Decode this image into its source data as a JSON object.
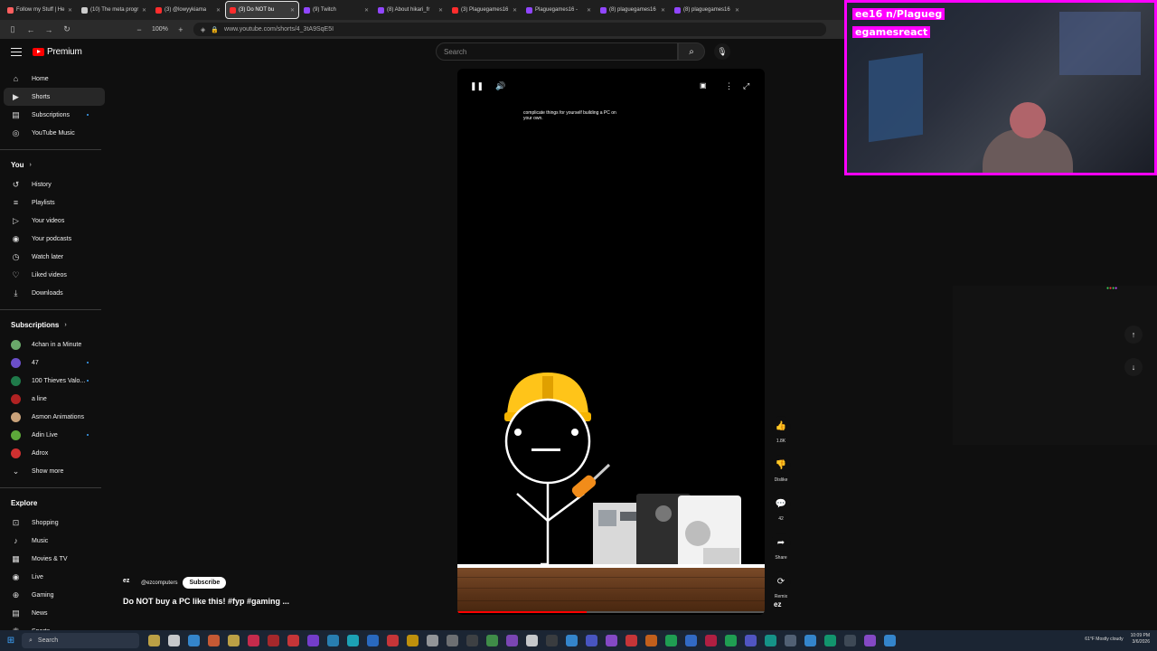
{
  "browser": {
    "tabs": [
      {
        "label": "Follow my Stuff | He",
        "color": "#ff5f5f",
        "active": false
      },
      {
        "label": "(10) The meta progr",
        "color": "#cccccc",
        "active": false
      },
      {
        "label": "(3) @lowyykiama",
        "color": "#ff2d2d",
        "active": false
      },
      {
        "label": "(3) Do NOT bu",
        "color": "#ff2d2d",
        "active": true
      },
      {
        "label": "(9) Twitch",
        "color": "#9146ff",
        "active": false
      },
      {
        "label": "(8) About hikari_fr",
        "color": "#9146ff",
        "active": false
      },
      {
        "label": "(3) Plaguegames16",
        "color": "#ff2d2d",
        "active": false
      },
      {
        "label": "Plaguegames16 -",
        "color": "#9146ff",
        "active": false
      },
      {
        "label": "(8) plaguegames16",
        "color": "#9146ff",
        "active": false
      },
      {
        "label": "(8) plaguegames16",
        "color": "#9146ff",
        "active": false
      }
    ],
    "zoom": "100%",
    "url": "www.youtube.com/shorts/4_3tA9SqE5I"
  },
  "header": {
    "logo_text": "Premium",
    "search_placeholder": "Search"
  },
  "sidebar": {
    "main": [
      {
        "label": "Home",
        "icon": "home-icon",
        "glyph": "⌂"
      },
      {
        "label": "Shorts",
        "icon": "shorts-icon",
        "glyph": "▶",
        "active": true
      },
      {
        "label": "Subscriptions",
        "icon": "subscriptions-icon",
        "glyph": "▤",
        "dot": true
      },
      {
        "label": "YouTube Music",
        "icon": "music-circle-icon",
        "glyph": "◎"
      }
    ],
    "you_heading": "You",
    "you": [
      {
        "label": "History",
        "icon": "history-icon",
        "glyph": "↺"
      },
      {
        "label": "Playlists",
        "icon": "playlists-icon",
        "glyph": "≡"
      },
      {
        "label": "Your videos",
        "icon": "your-videos-icon",
        "glyph": "▷"
      },
      {
        "label": "Your podcasts",
        "icon": "podcasts-icon",
        "glyph": "◉"
      },
      {
        "label": "Watch later",
        "icon": "clock-icon",
        "glyph": "◷"
      },
      {
        "label": "Liked videos",
        "icon": "like-icon",
        "glyph": "♡"
      },
      {
        "label": "Downloads",
        "icon": "download-icon",
        "glyph": "⤓"
      }
    ],
    "subs_heading": "Subscriptions",
    "subs": [
      {
        "label": "4chan in a Minute",
        "color": "#6aa86a"
      },
      {
        "label": "47",
        "color": "#6b4fc9",
        "dot": true
      },
      {
        "label": "100 Thieves Valo...",
        "color": "#1f7a4a",
        "dot": true
      },
      {
        "label": "a line",
        "color": "#b02222"
      },
      {
        "label": "Asmon Animations",
        "color": "#c9a27a"
      },
      {
        "label": "Adin Live",
        "color": "#5da83a",
        "dot": true
      },
      {
        "label": "Adrox",
        "color": "#d03030"
      }
    ],
    "show_more": "Show more",
    "explore_heading": "Explore",
    "explore": [
      {
        "label": "Shopping",
        "icon": "shopping-bag-icon",
        "glyph": "⊡"
      },
      {
        "label": "Music",
        "icon": "music-note-icon",
        "glyph": "♪"
      },
      {
        "label": "Movies & TV",
        "icon": "movies-icon",
        "glyph": "▦"
      },
      {
        "label": "Live",
        "icon": "live-icon",
        "glyph": "◉"
      },
      {
        "label": "Gaming",
        "icon": "gaming-icon",
        "glyph": "⊕"
      },
      {
        "label": "News",
        "icon": "news-icon",
        "glyph": "▤"
      },
      {
        "label": "Sports",
        "icon": "trophy-icon",
        "glyph": "♛"
      }
    ]
  },
  "short": {
    "caption": "complicate things for yourself building a PC on your own.",
    "progress": 0.42,
    "channel_logo": "ez",
    "channel": "@ezcomputers",
    "subscribe": "Subscribe",
    "title": "Do NOT buy a PC like this! #fyp #gaming ..."
  },
  "actions": [
    {
      "name": "like-button",
      "icon": "thumbs-up-icon",
      "glyph": "👍",
      "label": "1.8K"
    },
    {
      "name": "dislike-button",
      "icon": "thumbs-down-icon",
      "glyph": "👎",
      "label": "Dislike"
    },
    {
      "name": "comments-button",
      "icon": "comment-icon",
      "glyph": "💬",
      "label": "42"
    },
    {
      "name": "share-button",
      "icon": "share-icon",
      "glyph": "➦",
      "label": "Share"
    },
    {
      "name": "remix-button",
      "icon": "remix-icon",
      "glyph": "⟳",
      "label": "Remix"
    }
  ],
  "webcam": {
    "label_top": "ee16 n/Plagueg",
    "label_bottom": "egamesreact"
  },
  "taskbar": {
    "search": "Search",
    "weather": "61°F Mostly cloudy",
    "time": "10:09 PM",
    "date": "3/6/2026"
  }
}
